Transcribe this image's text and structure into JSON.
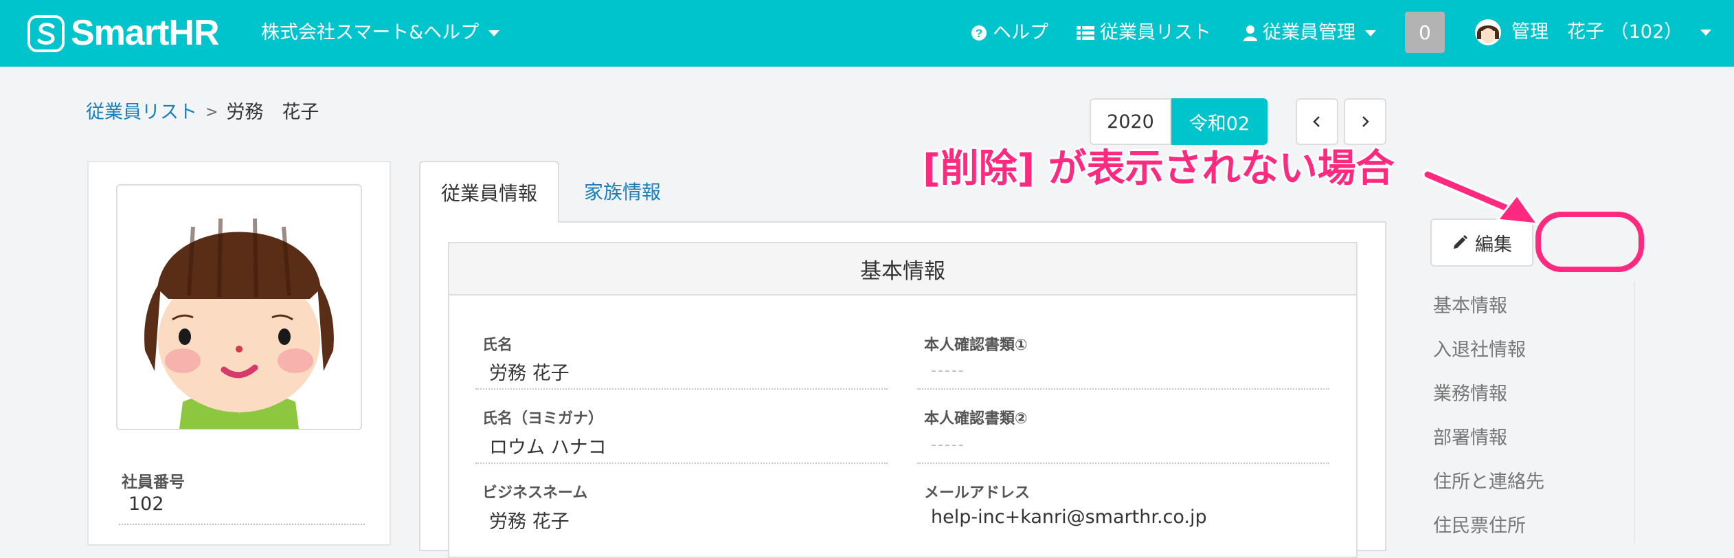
{
  "header": {
    "brand": "SmartHR",
    "company": "株式会社スマート&ヘルプ",
    "nav": {
      "help": "ヘルプ",
      "employee_list": "従業員リスト",
      "employee_manage": "従業員管理"
    },
    "notification_count": "0",
    "user": "管理　花子 （102）"
  },
  "breadcrumb": {
    "link": "従業員リスト",
    "separator": ">",
    "current": "労務　花子"
  },
  "year_selector": {
    "western": "2020",
    "era": "令和02"
  },
  "profile": {
    "employee_number_label": "社員番号",
    "employee_number": "102"
  },
  "tabs": {
    "employee_info": "従業員情報",
    "family_info": "家族情報"
  },
  "section": {
    "title": "基本情報",
    "fields": {
      "name_label": "氏名",
      "name": "労務 花子",
      "kana_label": "氏名（ヨミガナ）",
      "kana": "ロウム ハナコ",
      "business_name_label": "ビジネスネーム",
      "business_name": "労務 花子",
      "id_doc1_label": "本人確認書類①",
      "id_doc1": "-----",
      "id_doc2_label": "本人確認書類②",
      "id_doc2": "-----",
      "email_label": "メールアドレス",
      "email": "help-inc+kanri@smarthr.co.jp"
    }
  },
  "actions": {
    "edit": "編集"
  },
  "side_nav": [
    "基本情報",
    "入退社情報",
    "業務情報",
    "部署情報",
    "住所と連絡先",
    "住民票住所"
  ],
  "annotation": {
    "text": "[削除] が表示されない場合",
    "color": "#ff2a7f"
  },
  "colors": {
    "brand": "#00c4cc",
    "link": "#1a7fb8"
  }
}
